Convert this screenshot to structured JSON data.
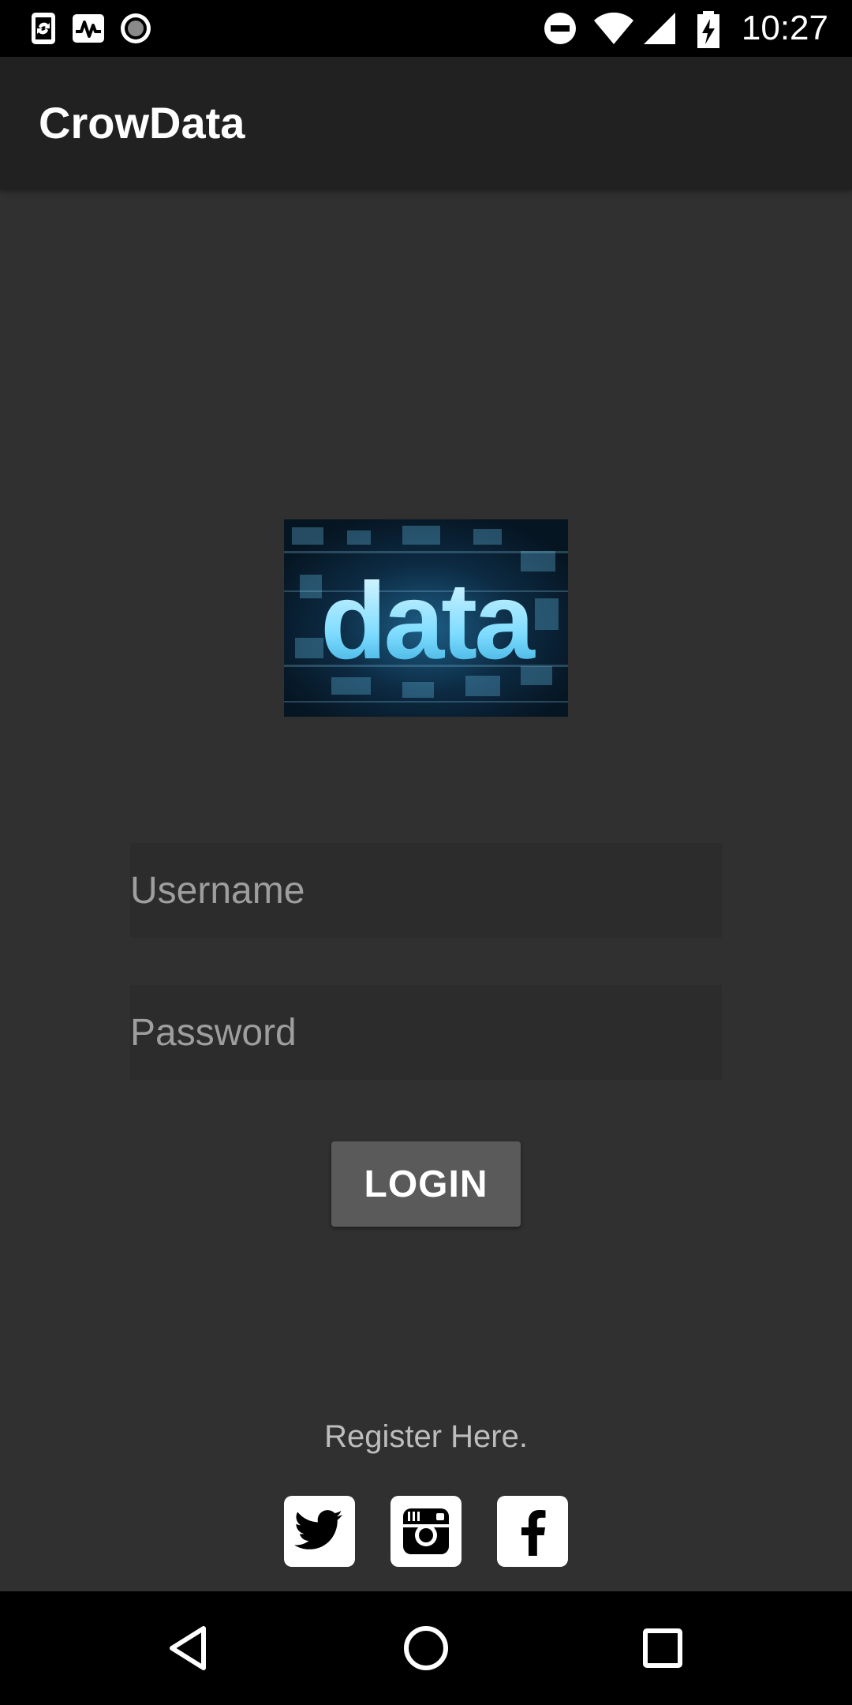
{
  "status_bar": {
    "time": "10:27",
    "icons": [
      "sync-phone-icon",
      "activity-icon",
      "record-icon",
      "do-not-disturb-icon",
      "wifi-icon",
      "cell-signal-icon",
      "battery-charging-icon"
    ]
  },
  "app_bar": {
    "title": "CrowData"
  },
  "logo": {
    "word": "data",
    "accent_color": "#39b6e6"
  },
  "login": {
    "username_placeholder": "Username",
    "password_placeholder": "Password",
    "button_label": "LOGIN"
  },
  "register": {
    "label": "Register Here."
  },
  "social": [
    "twitter-icon",
    "instagram-icon",
    "facebook-icon"
  ],
  "nav_bar": {
    "buttons": [
      "back-icon",
      "home-icon",
      "recents-icon"
    ]
  },
  "colors": {
    "background": "#303030",
    "app_bar": "#212121",
    "button": "#5a5a5a",
    "hint_text": "#9e9e9e"
  }
}
